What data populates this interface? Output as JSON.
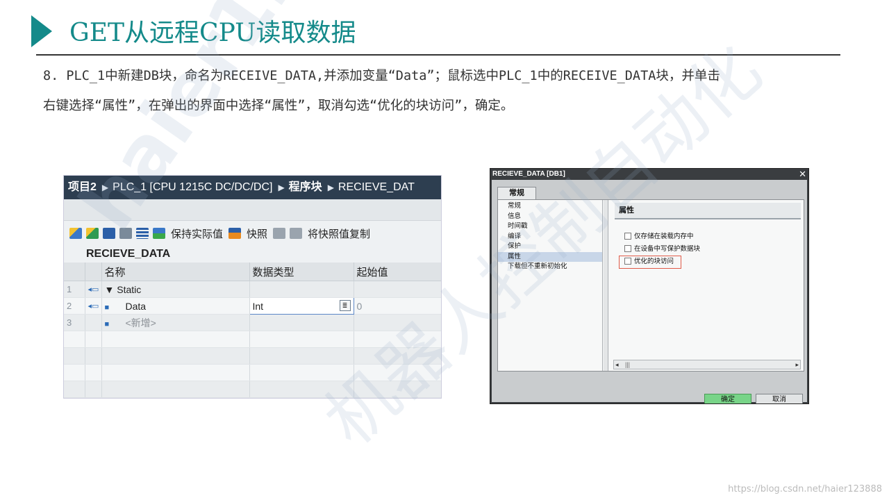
{
  "slide": {
    "title": "GET从远程CPU读取数据",
    "step_line1": "8. PLC_1中新建DB块，命名为RECEIVE_DATA,并添加变量“Data”；鼠标选中PLC_1中的RECEIVE_DATA块，并单击",
    "step_line2": "右键选择“属性”，在弹出的界面中选择“属性”，取消勾选“优化的块访问”，确定。",
    "watermark1": "haier123888",
    "watermark2": "机器人控制自动化",
    "footer_url": "https://blog.csdn.net/haier123888"
  },
  "tia": {
    "breadcrumb": [
      "项目2",
      "PLC_1 [CPU 1215C DC/DC/DC]",
      "程序块",
      "RECIEVE_DAT"
    ],
    "toolbar": {
      "keep_actual": "保持实际值",
      "snapshot": "快照",
      "copy_snapshot": "将快照值复制"
    },
    "db_name": "RECIEVE_DATA",
    "columns": {
      "name": "名称",
      "datatype": "数据类型",
      "start": "起始值"
    },
    "rows": [
      {
        "num": "1",
        "name": "Static",
        "type": "",
        "start": ""
      },
      {
        "num": "2",
        "name": "Data",
        "type": "Int",
        "start": "0"
      },
      {
        "num": "3",
        "name": "<新增>",
        "type": "",
        "start": ""
      }
    ]
  },
  "dialog": {
    "title": "RECIEVE_DATA [DB1]",
    "tab": "常规",
    "nav": [
      "常规",
      "信息",
      "时间戳",
      "编译",
      "保护",
      "属性",
      "下载但不重新初始化"
    ],
    "selected_nav": "属性",
    "section": "属性",
    "options": [
      "仅存储在装载内存中",
      "在设备中写保护数据块",
      "优化的块访问"
    ],
    "ok": "确定",
    "cancel": "取消"
  }
}
